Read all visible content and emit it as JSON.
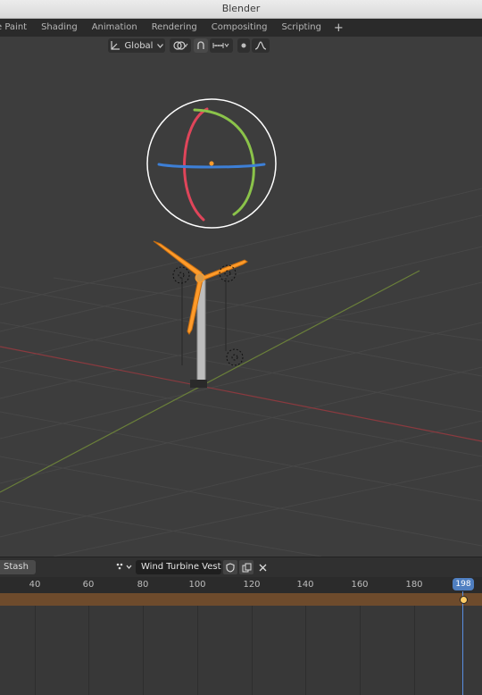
{
  "window": {
    "title": "Blender"
  },
  "workspace_tabs": [
    "e Paint",
    "Shading",
    "Animation",
    "Rendering",
    "Compositing",
    "Scripting"
  ],
  "workspace_add": "+",
  "viewport_header": {
    "transform_orientation": "Global",
    "icons": [
      "orientation-icon",
      "pivot-icon",
      "snap-icon",
      "snap-increment-icon",
      "proportional-icon",
      "falloff-icon"
    ]
  },
  "gizmo": {
    "colors": {
      "x": "#e0455a",
      "y": "#8bc34a",
      "z": "#3d7fd6",
      "ring": "#ffffff"
    }
  },
  "turbine": {
    "selection_color": "#ff9b2a"
  },
  "timeline": {
    "stash_label": "Stash",
    "action_name": "Wind Turbine Vesta...",
    "ruler_labels": [
      "40",
      "60",
      "80",
      "100",
      "120",
      "140",
      "160",
      "180"
    ],
    "current_frame": "198",
    "summary_color": "#6e4b2c",
    "playhead_color": "#5a8ee0"
  }
}
